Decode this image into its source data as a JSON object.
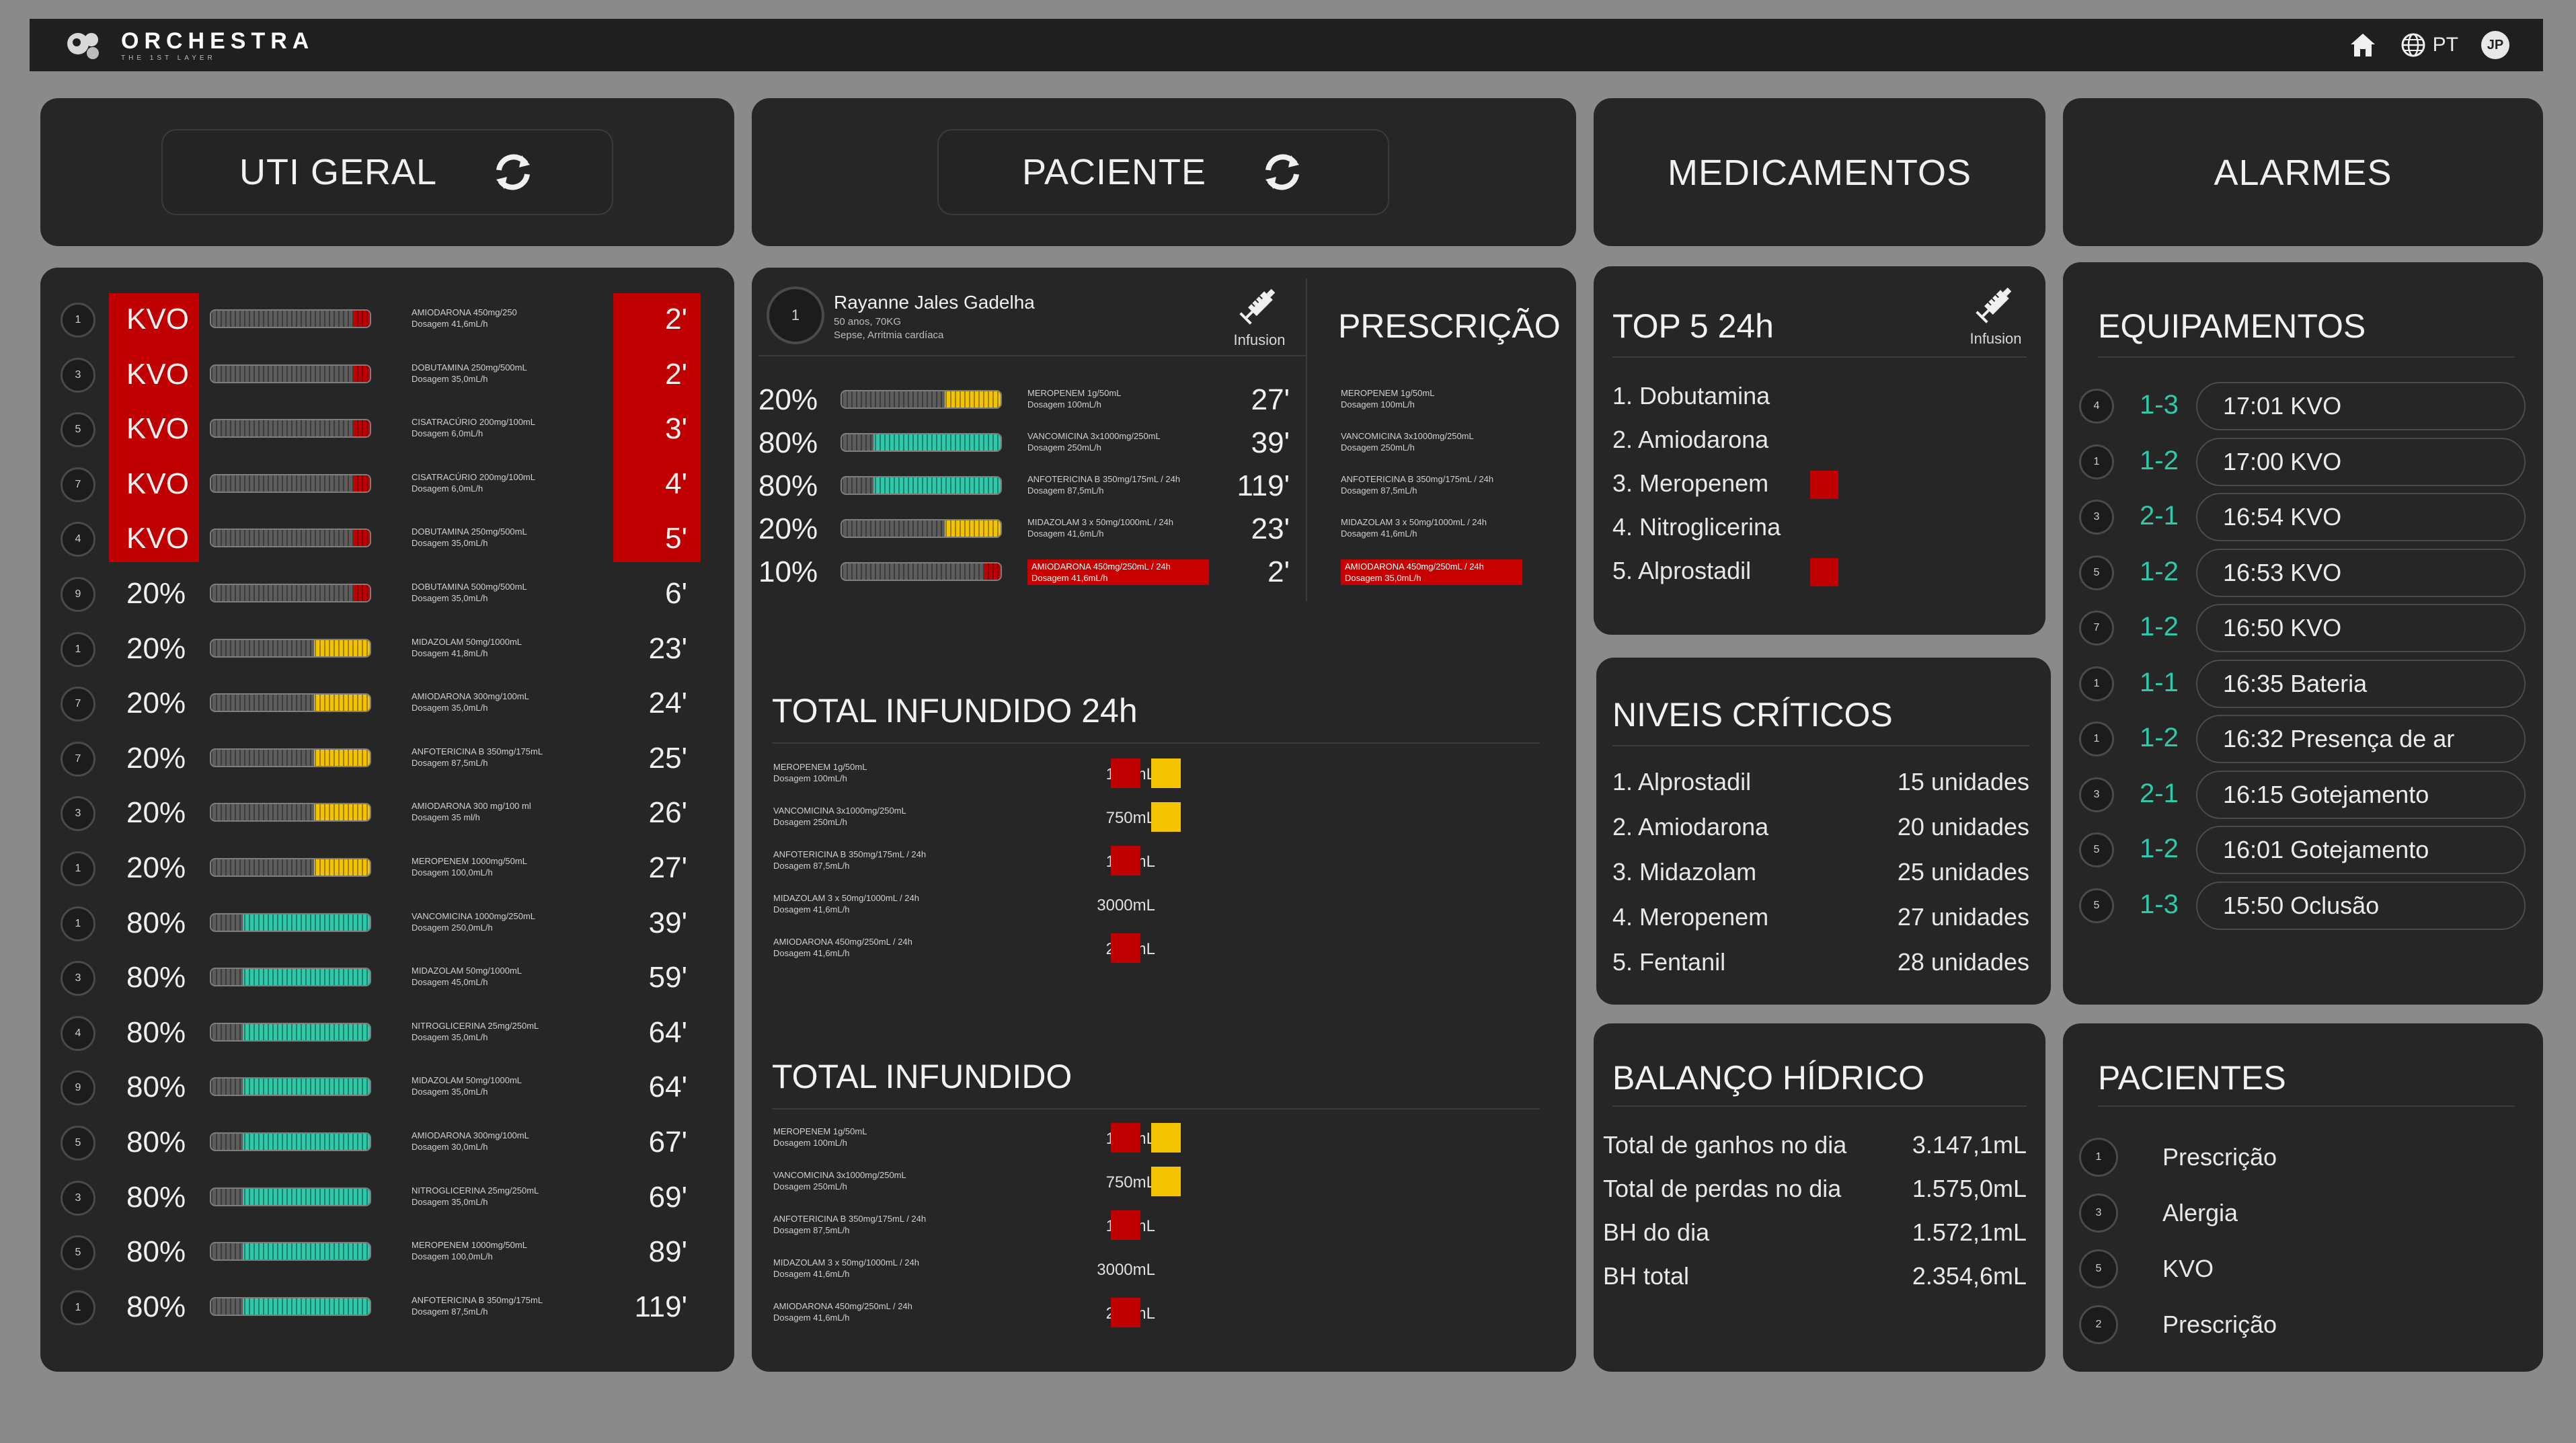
{
  "app": {
    "brand": "ORCHESTRA",
    "tagline": "THE 1ST LAYER",
    "language": "PT",
    "user_initials": "JP"
  },
  "colors": {
    "alert_red": "#c00000",
    "warning_yellow": "#f5c400",
    "ok_teal": "#2fc8a8",
    "panel": "#262626"
  },
  "headers": {
    "uti": "UTI GERAL",
    "paciente": "PACIENTE",
    "medicamentos": "MEDICAMENTOS",
    "alarmes": "ALARMES"
  },
  "uti_rows": [
    {
      "bed": "1",
      "status": "KVO",
      "drug1": "AMIODARONA 450mg/250",
      "drug2": "Dosagem 41,6mL/h",
      "time": "2'",
      "level": "red",
      "pct": 0.1,
      "red": true
    },
    {
      "bed": "3",
      "status": "KVO",
      "drug1": "DOBUTAMINA 250mg/500mL",
      "drug2": "Dosagem 35,0mL/h",
      "time": "2'",
      "level": "red",
      "pct": 0.1,
      "red": true
    },
    {
      "bed": "5",
      "status": "KVO",
      "drug1": "CISATRACÚRIO 200mg/100mL",
      "drug2": "Dosagem 6,0mL/h",
      "time": "3'",
      "level": "red",
      "pct": 0.1,
      "red": true
    },
    {
      "bed": "7",
      "status": "KVO",
      "drug1": "CISATRACÚRIO 200mg/100mL",
      "drug2": "Dosagem 6,0mL/h",
      "time": "4'",
      "level": "red",
      "pct": 0.1,
      "red": true
    },
    {
      "bed": "4",
      "status": "KVO",
      "drug1": "DOBUTAMINA 250mg/500mL",
      "drug2": "Dosagem 35,0mL/h",
      "time": "5'",
      "level": "red",
      "pct": 0.1,
      "red": true
    },
    {
      "bed": "9",
      "status": "20%",
      "drug1": "DOBUTAMINA 500mg/500mL",
      "drug2": "Dosagem 35,0mL/h",
      "time": "6'",
      "level": "red",
      "pct": 0.1,
      "red": false
    },
    {
      "bed": "1",
      "status": "20%",
      "drug1": "MIDAZOLAM 50mg/1000mL",
      "drug2": "Dosagem 41,8mL/h",
      "time": "23'",
      "level": "yellow",
      "pct": 0.35,
      "red": false
    },
    {
      "bed": "7",
      "status": "20%",
      "drug1": "AMIODARONA 300mg/100mL",
      "drug2": "Dosagem 35,0mL/h",
      "time": "24'",
      "level": "yellow",
      "pct": 0.35,
      "red": false
    },
    {
      "bed": "7",
      "status": "20%",
      "drug1": "ANFOTERICINA B 350mg/175mL",
      "drug2": "Dosagem 87,5mL/h",
      "time": "25'",
      "level": "yellow",
      "pct": 0.35,
      "red": false
    },
    {
      "bed": "3",
      "status": "20%",
      "drug1": "AMIODARONA 300 mg/100 ml",
      "drug2": "Dosagem 35 ml/h",
      "time": "26'",
      "level": "yellow",
      "pct": 0.35,
      "red": false
    },
    {
      "bed": "1",
      "status": "20%",
      "drug1": "MEROPENEM 1000mg/50mL",
      "drug2": "Dosagem 100,0mL/h",
      "time": "27'",
      "level": "yellow",
      "pct": 0.35,
      "red": false
    },
    {
      "bed": "1",
      "status": "80%",
      "drug1": "VANCOMICINA 1000mg/250mL",
      "drug2": "Dosagem 250,0mL/h",
      "time": "39'",
      "level": "teal",
      "pct": 0.8,
      "red": false
    },
    {
      "bed": "3",
      "status": "80%",
      "drug1": "MIDAZOLAM 50mg/1000mL",
      "drug2": "Dosagem 45,0mL/h",
      "time": "59'",
      "level": "teal",
      "pct": 0.8,
      "red": false
    },
    {
      "bed": "4",
      "status": "80%",
      "drug1": "NITROGLICERINA 25mg/250mL",
      "drug2": "Dosagem 35,0mL/h",
      "time": "64'",
      "level": "teal",
      "pct": 0.8,
      "red": false
    },
    {
      "bed": "9",
      "status": "80%",
      "drug1": "MIDAZOLAM 50mg/1000mL",
      "drug2": "Dosagem 35,0mL/h",
      "time": "64'",
      "level": "teal",
      "pct": 0.8,
      "red": false
    },
    {
      "bed": "5",
      "status": "80%",
      "drug1": "AMIODARONA 300mg/100mL",
      "drug2": "Dosagem 30,0mL/h",
      "time": "67'",
      "level": "teal",
      "pct": 0.8,
      "red": false
    },
    {
      "bed": "3",
      "status": "80%",
      "drug1": "NITROGLICERINA 25mg/250mL",
      "drug2": "Dosagem 35,0mL/h",
      "time": "69'",
      "level": "teal",
      "pct": 0.8,
      "red": false
    },
    {
      "bed": "5",
      "status": "80%",
      "drug1": "MEROPENEM 1000mg/50mL",
      "drug2": "Dosagem 100,0mL/h",
      "time": "89'",
      "level": "teal",
      "pct": 0.8,
      "red": false
    },
    {
      "bed": "1",
      "status": "80%",
      "drug1": "ANFOTERICINA B 350mg/175mL",
      "drug2": "Dosagem 87,5mL/h",
      "time": "119'",
      "level": "teal",
      "pct": 0.8,
      "red": false
    }
  ],
  "patient": {
    "bed": "1",
    "name": "Rayanne Jales Gadelha",
    "info": "50 anos, 70KG",
    "diagnosis": "Sepse, Arritmia cardíaca",
    "infusion_label": "Infusion",
    "prescricao_title": "PRESCRIÇÃO",
    "infusions": [
      {
        "pct": "20%",
        "drug1": "MEROPENEM 1g/50mL",
        "drug2": "Dosagem 100mL/h",
        "time": "27'",
        "level": "yellow",
        "fill": 0.35,
        "red": false
      },
      {
        "pct": "80%",
        "drug1": "VANCOMICINA 3x1000mg/250mL",
        "drug2": "Dosagem 250mL/h",
        "time": "39'",
        "level": "teal",
        "fill": 0.8,
        "red": false
      },
      {
        "pct": "80%",
        "drug1": "ANFOTERICINA B 350mg/175mL / 24h",
        "drug2": "Dosagem 87,5mL/h",
        "time": "119'",
        "level": "teal",
        "fill": 0.8,
        "red": false
      },
      {
        "pct": "20%",
        "drug1": "MIDAZOLAM 3 x 50mg/1000mL / 24h",
        "drug2": "Dosagem 41,6mL/h",
        "time": "23'",
        "level": "yellow",
        "fill": 0.35,
        "red": false
      },
      {
        "pct": "10%",
        "drug1": "AMIODARONA 450mg/250mL / 24h",
        "drug2": "Dosagem 41,6mL/h",
        "time": "2'",
        "level": "red",
        "fill": 0.1,
        "red": true
      }
    ],
    "prescriptions": [
      {
        "drug1": "MEROPENEM 1g/50mL",
        "drug2": "Dosagem 100mL/h",
        "red": false
      },
      {
        "drug1": "VANCOMICINA 3x1000mg/250mL",
        "drug2": "Dosagem 250mL/h",
        "red": false
      },
      {
        "drug1": "ANFOTERICINA B 350mg/175mL / 24h",
        "drug2": "Dosagem 87,5mL/h",
        "red": false
      },
      {
        "drug1": "MIDAZOLAM 3 x 50mg/1000mL / 24h",
        "drug2": "Dosagem 41,6mL/h",
        "red": false
      },
      {
        "drug1": "AMIODARONA 450mg/250mL / 24h",
        "drug2": "Dosagem 35,0mL/h",
        "red": true
      }
    ],
    "total24_title": "TOTAL INFUNDIDO 24h",
    "total24": [
      {
        "drug1": "MEROPENEM 1g/50mL",
        "drug2": "Dosagem 100mL/h",
        "ml": "180mL",
        "red": true,
        "yellow": true
      },
      {
        "drug1": "VANCOMICINA 3x1000mg/250mL",
        "drug2": "Dosagem 250mL/h",
        "ml": "750mL",
        "red": false,
        "yellow": true
      },
      {
        "drug1": "ANFOTERICINA B 350mg/175mL / 24h",
        "drug2": "Dosagem 87,5mL/h",
        "ml": "175mL",
        "red": true,
        "yellow": false
      },
      {
        "drug1": "MIDAZOLAM 3 x 50mg/1000mL / 24h",
        "drug2": "Dosagem 41,6mL/h",
        "ml": "3000mL",
        "red": false,
        "yellow": false
      },
      {
        "drug1": "AMIODARONA 450mg/250mL / 24h",
        "drug2": "Dosagem 41,6mL/h",
        "ml": "250mL",
        "red": true,
        "yellow": false
      }
    ],
    "total_title": "TOTAL INFUNDIDO",
    "total": [
      {
        "drug1": "MEROPENEM 1g/50mL",
        "drug2": "Dosagem 100mL/h",
        "ml": "180mL",
        "red": true,
        "yellow": true
      },
      {
        "drug1": "VANCOMICINA 3x1000mg/250mL",
        "drug2": "Dosagem 250mL/h",
        "ml": "750mL",
        "red": false,
        "yellow": true
      },
      {
        "drug1": "ANFOTERICINA B 350mg/175mL / 24h",
        "drug2": "Dosagem 87,5mL/h",
        "ml": "175mL",
        "red": true,
        "yellow": false
      },
      {
        "drug1": "MIDAZOLAM 3 x 50mg/1000mL / 24h",
        "drug2": "Dosagem 41,6mL/h",
        "ml": "3000mL",
        "red": false,
        "yellow": false
      },
      {
        "drug1": "AMIODARONA 450mg/250mL / 24h",
        "drug2": "Dosagem 41,6mL/h",
        "ml": "250mL",
        "red": true,
        "yellow": false
      }
    ]
  },
  "top5": {
    "title": "TOP 5 24h",
    "infusion_label": "Infusion",
    "items": [
      {
        "label": "1. Dobutamina",
        "flag": false
      },
      {
        "label": "2. Amiodarona",
        "flag": false
      },
      {
        "label": "3. Meropenem",
        "flag": true
      },
      {
        "label": "4. Nitroglicerina",
        "flag": false
      },
      {
        "label": "5. Alprostadil",
        "flag": true
      }
    ]
  },
  "criticos": {
    "title": "NIVEIS CRÍTICOS",
    "items": [
      {
        "label": "1. Alprostadil",
        "value": "15 unidades"
      },
      {
        "label": "2. Amiodarona",
        "value": "20 unidades"
      },
      {
        "label": "3. Midazolam",
        "value": "25 unidades"
      },
      {
        "label": "4. Meropenem",
        "value": "27 unidades"
      },
      {
        "label": "5. Fentanil",
        "value": "28 unidades"
      }
    ]
  },
  "balanco": {
    "title": "BALANÇO HÍDRICO",
    "items": [
      {
        "label": "Total de ganhos no dia",
        "value": "3.147,1mL"
      },
      {
        "label": "Total de perdas no dia",
        "value": "1.575,0mL"
      },
      {
        "label": "BH do dia",
        "value": "1.572,1mL"
      },
      {
        "label": "BH total",
        "value": "2.354,6mL"
      }
    ]
  },
  "equipamentos": {
    "title": "EQUIPAMENTOS",
    "items": [
      {
        "bed": "4",
        "room": "1-3",
        "text": "17:01 KVO"
      },
      {
        "bed": "1",
        "room": "1-2",
        "text": "17:00 KVO"
      },
      {
        "bed": "3",
        "room": "2-1",
        "text": "16:54 KVO"
      },
      {
        "bed": "5",
        "room": "1-2",
        "text": "16:53 KVO"
      },
      {
        "bed": "7",
        "room": "1-2",
        "text": "16:50 KVO"
      },
      {
        "bed": "1",
        "room": "1-1",
        "text": "16:35 Bateria"
      },
      {
        "bed": "1",
        "room": "1-2",
        "text": "16:32 Presença de ar"
      },
      {
        "bed": "3",
        "room": "2-1",
        "text": "16:15 Gotejamento"
      },
      {
        "bed": "5",
        "room": "1-2",
        "text": "16:01 Gotejamento"
      },
      {
        "bed": "5",
        "room": "1-3",
        "text": "15:50 Oclusão"
      }
    ]
  },
  "pacientes": {
    "title": "PACIENTES",
    "items": [
      {
        "bed": "1",
        "text": "Prescrição"
      },
      {
        "bed": "3",
        "text": "Alergia"
      },
      {
        "bed": "5",
        "text": "KVO"
      },
      {
        "bed": "2",
        "text": "Prescrição"
      }
    ]
  }
}
